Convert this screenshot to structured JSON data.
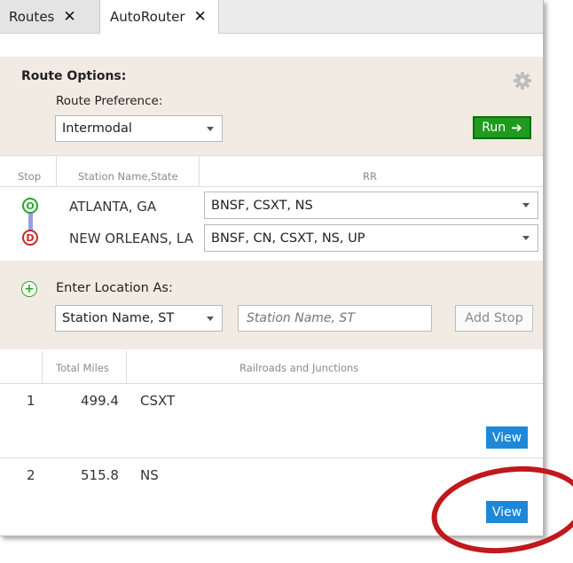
{
  "tabs": [
    {
      "label": "Routes",
      "close": "✕"
    },
    {
      "label": "AutoRouter",
      "close": "✕"
    }
  ],
  "route_options": {
    "title": "Route Options:",
    "preference_label": "Route Preference:",
    "preference_value": "Intermodal",
    "run_label": "Run",
    "run_icon": "➔",
    "settings_icon": "gear-icon"
  },
  "stops_table": {
    "headers": {
      "stop": "Stop",
      "station": "Station Name,State",
      "rr": "RR"
    },
    "rows": [
      {
        "marker": "O",
        "station": "ATLANTA, GA",
        "rr": "BNSF, CSXT, NS"
      },
      {
        "marker": "D",
        "station": "NEW ORLEANS, LA",
        "rr": "BNSF, CN, CSXT, NS, UP"
      }
    ]
  },
  "add_stop": {
    "plus": "+",
    "label": "Enter Location As:",
    "format_value": "Station Name, ST",
    "input_placeholder": "Station Name, ST",
    "button_label": "Add Stop"
  },
  "results": {
    "headers": {
      "miles": "Total Miles",
      "railroads": "Railroads and Junctions"
    },
    "rows": [
      {
        "index": "1",
        "miles": "499.4",
        "railroads": "CSXT",
        "view_label": "View"
      },
      {
        "index": "2",
        "miles": "515.8",
        "railroads": "NS",
        "view_label": "View"
      }
    ]
  },
  "colors": {
    "run_button": "#1f9a1f",
    "view_button": "#1e88d8",
    "origin_marker": "#2aa52a",
    "destination_marker": "#c62828",
    "section_background": "#f2ebe3",
    "highlight_circle": "#c0181b"
  }
}
